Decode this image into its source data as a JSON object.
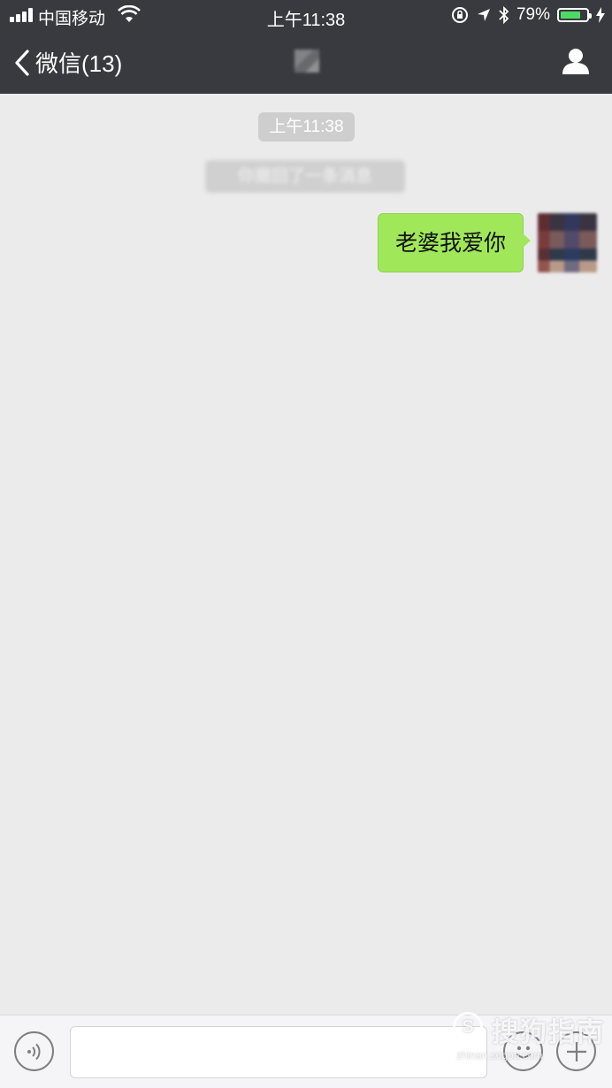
{
  "status_bar": {
    "carrier": "中国移动",
    "time": "上午11:38",
    "battery_percent": "79%",
    "battery_level": 0.79
  },
  "nav": {
    "back_label": "微信(13)",
    "icons": {
      "back": "chevron-left-icon",
      "profile": "person-icon"
    }
  },
  "chat": {
    "timestamp": "上午11:38",
    "system_notice": "你撤回了一条消息",
    "messages": [
      {
        "from": "me",
        "text": "老婆我爱你"
      }
    ]
  },
  "input_bar": {
    "value": "",
    "icons": {
      "voice": "voice-icon",
      "emoji": "emoji-icon",
      "more": "plus-icon"
    }
  },
  "watermark": {
    "logo": "S",
    "text": "搜狗指南",
    "sub": "zhinan.sogou.com"
  },
  "colors": {
    "nav_bg": "#393a3f",
    "chat_bg": "#ebebeb",
    "bubble_green": "#a0e75a",
    "battery_green": "#4cd964"
  }
}
